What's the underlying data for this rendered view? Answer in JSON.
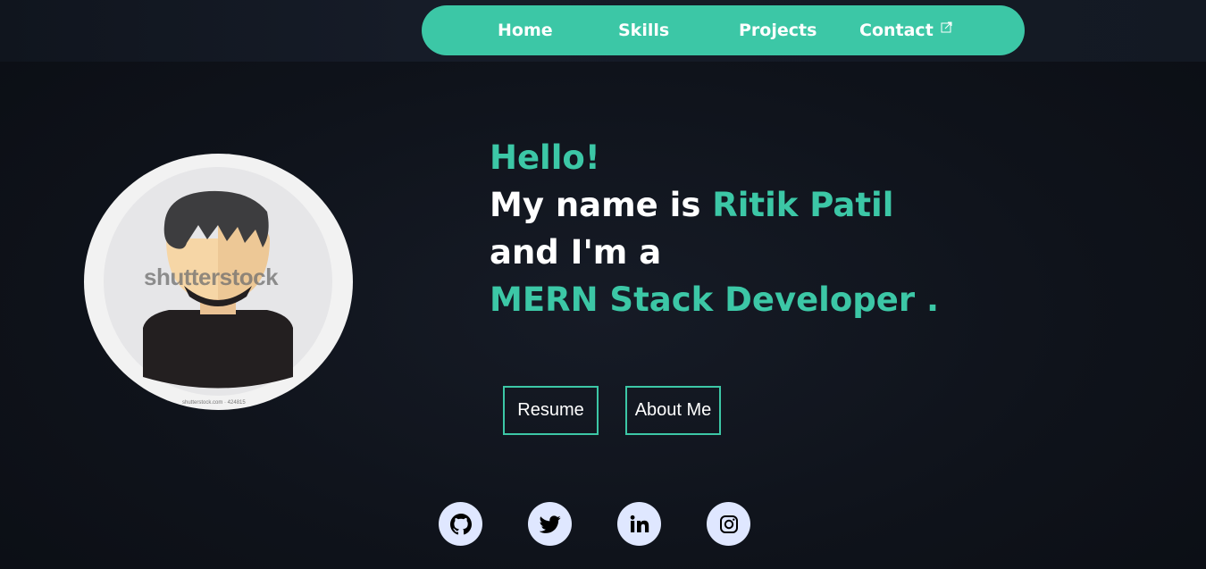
{
  "nav": {
    "items": [
      {
        "label": "Home"
      },
      {
        "label": "Skills"
      },
      {
        "label": "Projects"
      },
      {
        "label": "Contact"
      }
    ],
    "contact_icon": "external-link-icon"
  },
  "avatar": {
    "watermark": "shutterstock",
    "credit": "shutterstock.com · 424815"
  },
  "hero": {
    "greeting": "Hello!",
    "name_prefix": "My name is ",
    "name": "Ritik Patil",
    "role_prefix": "and I'm a",
    "role": "MERN Stack Developer ."
  },
  "buttons": {
    "resume": "Resume",
    "about": "About Me"
  },
  "social": [
    "github-icon",
    "twitter-icon",
    "linkedin-icon",
    "instagram-icon"
  ],
  "colors": {
    "accent": "#3cc7a6",
    "background": "#0f131b",
    "social_bg": "#dfe7ff"
  }
}
